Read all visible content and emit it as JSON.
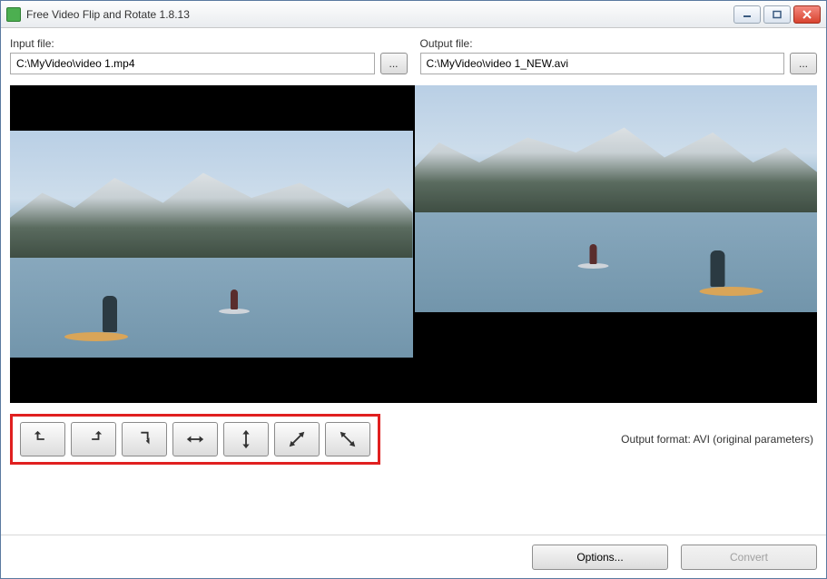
{
  "window": {
    "title": "Free Video Flip and Rotate 1.8.13"
  },
  "files": {
    "input_label": "Input file:",
    "input_value": "C:\\MyVideo\\video 1.mp4",
    "output_label": "Output file:",
    "output_value": "C:\\MyVideo\\video 1_NEW.avi",
    "browse_label": "..."
  },
  "toolbar": {
    "buttons": [
      {
        "name": "rotate-ccw",
        "icon": "rotate-ccw-icon"
      },
      {
        "name": "rotate-cw",
        "icon": "rotate-cw-icon"
      },
      {
        "name": "rotate-180",
        "icon": "rotate-180-icon"
      },
      {
        "name": "flip-horizontal",
        "icon": "flip-horizontal-icon"
      },
      {
        "name": "flip-vertical",
        "icon": "flip-vertical-icon"
      },
      {
        "name": "flip-diagonal-1",
        "icon": "flip-diagonal-1-icon"
      },
      {
        "name": "flip-diagonal-2",
        "icon": "flip-diagonal-2-icon"
      }
    ]
  },
  "status": {
    "output_format_label": "Output format: AVI (original parameters)"
  },
  "footer": {
    "options_label": "Options...",
    "convert_label": "Convert"
  }
}
